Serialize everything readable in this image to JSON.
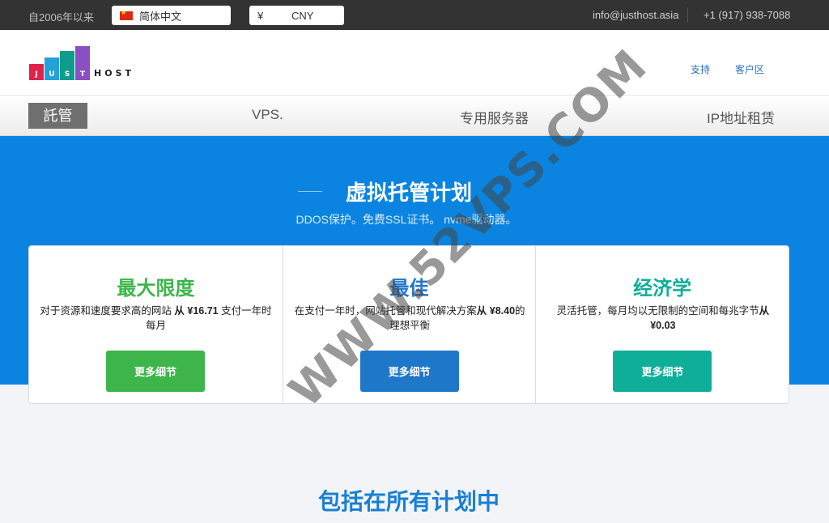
{
  "topbar": {
    "since": "自2006年以来",
    "language": "简体中文",
    "currency_symbol": "¥",
    "currency_code": "CNY",
    "email": "info@justhost.asia",
    "phone": "+1 (917) 938-7088"
  },
  "header": {
    "logo_letters": [
      "J",
      "U",
      "S",
      "T"
    ],
    "logo_host": "HOST",
    "links": [
      "支持",
      "客户区"
    ]
  },
  "nav": {
    "items": [
      "託管",
      "VPS.",
      "专用服务器",
      "IP地址租赁"
    ],
    "active_index": 0
  },
  "hero": {
    "title": "虚拟托管计划",
    "subtitle": "DDOS保护。免费SSL证书。 nvme驱动器。"
  },
  "plans": [
    {
      "name": "最大限度",
      "desc_before": "对于资源和速度要求高的网站",
      "price": "从 ¥16.71",
      "desc_after": "支付一年时每月",
      "button": "更多细节",
      "color": "#3db54a"
    },
    {
      "name": "最佳",
      "desc_before": "在支付一年时，网站托管和现代解决方案",
      "price": "从 ¥8.40",
      "desc_after": "的理想平衡",
      "button": "更多细节",
      "color": "#1f77c9"
    },
    {
      "name": "经济学",
      "desc_before": "灵活托管，每月均以无限制的空间和每兆字节",
      "price": "从 ¥0.03",
      "desc_after": "",
      "button": "更多细节",
      "color": "#0fae99"
    }
  ],
  "included_title": "包括在所有计划中",
  "included_color": "#1a7fd4",
  "watermark": "WWW.52VPS.COM",
  "colors": {
    "hero_bg": "#0a84e0",
    "topbar_bg": "#333333",
    "logo_bars": [
      "#e0224b",
      "#23a1d8",
      "#0f9c8c",
      "#8a4fc2"
    ]
  }
}
